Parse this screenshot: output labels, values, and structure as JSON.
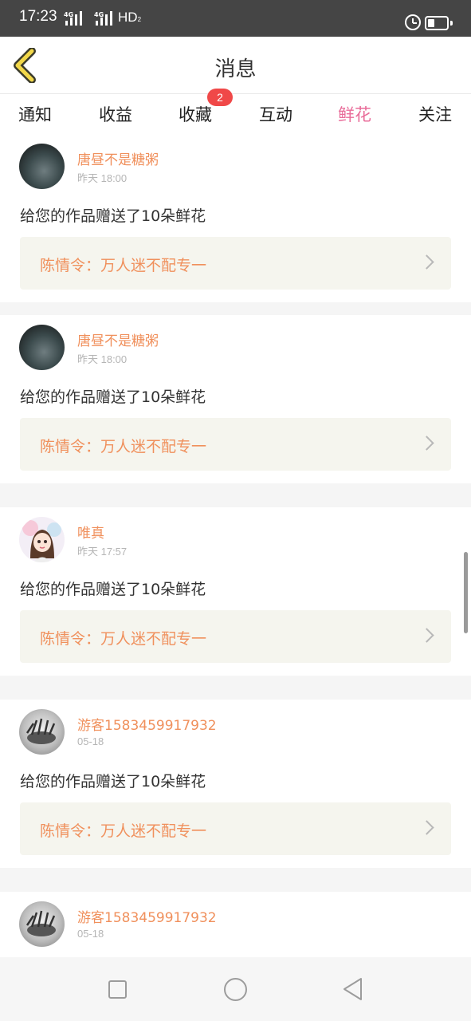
{
  "status_bar": {
    "time": "17:23",
    "signal1": "4G",
    "signal2": "4G",
    "hd": "HD",
    "hd_sub": "2",
    "battery_level": 0.35
  },
  "header": {
    "title": "消息",
    "back_icon": "chevron-left-icon"
  },
  "tabs": [
    {
      "label": "通知",
      "active": false
    },
    {
      "label": "收益",
      "active": false
    },
    {
      "label": "收藏",
      "active": false,
      "badge": "2"
    },
    {
      "label": "互动",
      "active": false
    },
    {
      "label": "鲜花",
      "active": true
    },
    {
      "label": "关注",
      "active": false
    }
  ],
  "messages": [
    {
      "user": "唐昼不是糖粥",
      "date": "昨天 18:00",
      "text": "给您的作品赠送了10朵鲜花",
      "work_title": "陈情令：万人迷不配专一",
      "avatar": "dark-avatar"
    },
    {
      "user": "唐昼不是糖粥",
      "date": "昨天 18:00",
      "text": "给您的作品赠送了10朵鲜花",
      "work_title": "陈情令：万人迷不配专一",
      "avatar": "dark-avatar"
    },
    {
      "user": "唯真",
      "date": "昨天 17:57",
      "text": "给您的作品赠送了10朵鲜花",
      "work_title": "陈情令：万人迷不配专一",
      "avatar": "girl-avatar"
    },
    {
      "user": "游客1583459917932",
      "date": "05-18",
      "text": "给您的作品赠送了10朵鲜花",
      "work_title": "陈情令：万人迷不配专一",
      "avatar": "sketch-avatar"
    },
    {
      "user": "游客1583459917932",
      "date": "05-18",
      "text": "",
      "work_title": "",
      "avatar": "sketch-avatar"
    }
  ],
  "colors": {
    "accent_pink": "#e96d9a",
    "accent_orange": "#f0905c",
    "badge_red": "#f04848",
    "card_bg": "#f5f5ee"
  },
  "nav": {
    "recents_icon": "square-icon",
    "home_icon": "circle-icon",
    "back_icon": "triangle-back-icon"
  }
}
